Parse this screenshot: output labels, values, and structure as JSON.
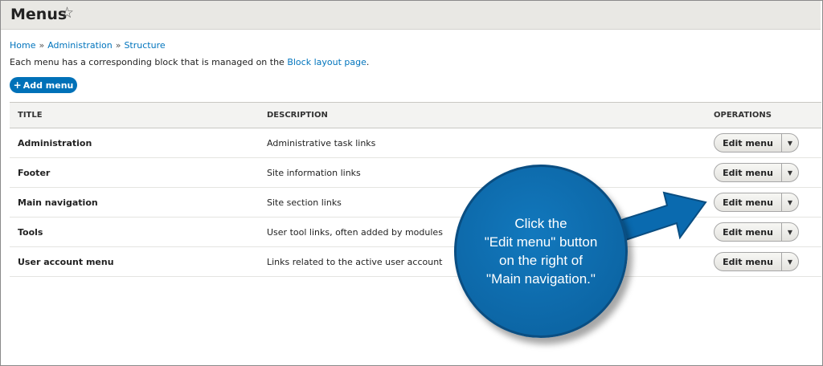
{
  "header": {
    "title": "Menus",
    "star_icon": "star-outline-icon"
  },
  "breadcrumb": {
    "items": [
      "Home",
      "Administration",
      "Structure"
    ],
    "separator": "»"
  },
  "intro": {
    "prefix": "Each menu has a corresponding block that is managed on the",
    "link": "Block layout page",
    "suffix": "."
  },
  "add_button": {
    "label": "Add menu",
    "icon": "plus-icon"
  },
  "table": {
    "headers": [
      "TITLE",
      "DESCRIPTION",
      "OPERATIONS"
    ],
    "rows": [
      {
        "title": "Administration",
        "description": "Administrative task links",
        "operation": "Edit menu"
      },
      {
        "title": "Footer",
        "description": "Site information links",
        "operation": "Edit menu"
      },
      {
        "title": "Main navigation",
        "description": "Site section links",
        "operation": "Edit menu"
      },
      {
        "title": "Tools",
        "description": "User tool links, often added by modules",
        "operation": "Edit menu"
      },
      {
        "title": "User account menu",
        "description": "Links related to the active user account",
        "operation": "Edit menu"
      }
    ]
  },
  "callout": {
    "lines": [
      "Click the",
      "\"Edit menu\" button",
      "on the right of",
      "\"Main navigation.\""
    ]
  },
  "colors": {
    "accent": "#0071b8",
    "link": "#0074bd",
    "header_bg": "#e9e8e4",
    "callout_bg": "#0a6aaf"
  }
}
